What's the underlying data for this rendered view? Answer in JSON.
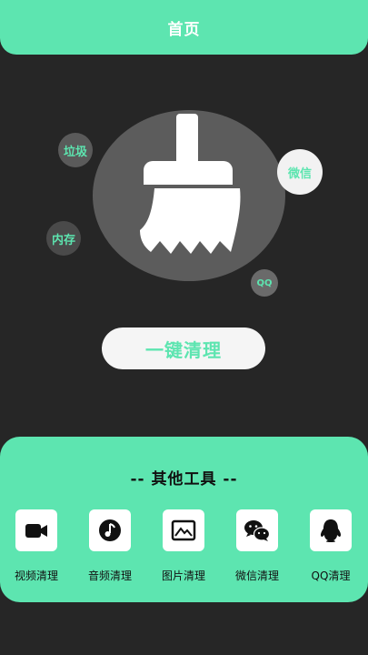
{
  "header": {
    "title": "首页"
  },
  "bubbles": {
    "laji": "垃圾",
    "weixin": "微信",
    "neicun": "内存",
    "qq": "QQ"
  },
  "main": {
    "clean_button_label": "一键清理"
  },
  "tools": {
    "title": "--  其他工具  --",
    "items": [
      {
        "label": "视频清理",
        "icon": "video-camera-icon"
      },
      {
        "label": "音频清理",
        "icon": "music-note-icon"
      },
      {
        "label": "图片清理",
        "icon": "image-icon"
      },
      {
        "label": "微信清理",
        "icon": "wechat-icon"
      },
      {
        "label": "QQ清理",
        "icon": "qq-penguin-icon"
      }
    ]
  },
  "colors": {
    "accent": "#5de5b0",
    "background": "#262626"
  }
}
